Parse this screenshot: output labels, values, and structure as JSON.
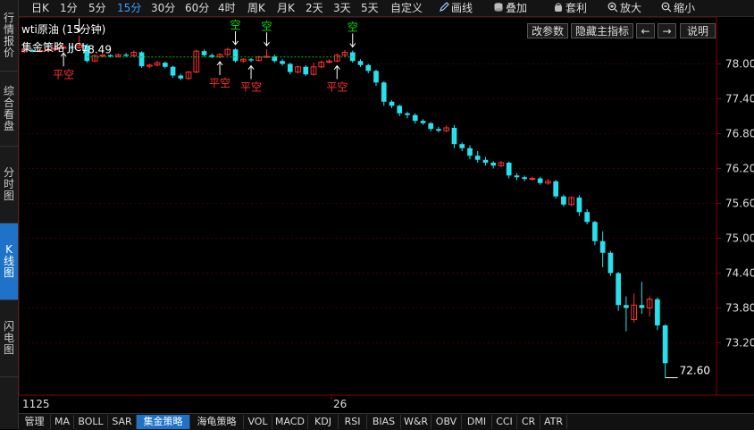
{
  "sidebar": {
    "tabs": [
      {
        "label": "行情报价",
        "active": false
      },
      {
        "label": "综合看盘",
        "active": false
      },
      {
        "label": "分时图",
        "active": false
      },
      {
        "label": "K线图",
        "active": true
      },
      {
        "label": "闪电图",
        "active": false
      }
    ]
  },
  "toolbar": {
    "periods": [
      "日K",
      "1分",
      "5分",
      "15分",
      "30分",
      "60分",
      "4时",
      "周K",
      "月K",
      "2天",
      "3天",
      "5天",
      "自定义"
    ],
    "active_period": "15分",
    "tools": [
      {
        "label": "画线",
        "icon": "pencil-icon"
      },
      {
        "label": "叠加",
        "icon": "database-icon"
      },
      {
        "label": "套利",
        "icon": "bag-icon"
      },
      {
        "label": "放大",
        "icon": "zoom-in-icon"
      },
      {
        "label": "缩小",
        "icon": "zoom-out-icon"
      }
    ]
  },
  "chart_header": {
    "title": "wti原油 (15分钟)",
    "strategy": "集金策略  JJCL"
  },
  "chart_controls": {
    "params": "改参数",
    "hide_indicator": "隐藏主指标",
    "prev": "←",
    "next": "→",
    "help": "说明"
  },
  "chart_data": {
    "type": "candlestick",
    "y_ticks": [
      "78.00",
      "77.40",
      "76.80",
      "76.20",
      "75.60",
      "75.00",
      "74.40",
      "73.80",
      "73.20"
    ],
    "x_labels": [
      "1125",
      "26"
    ],
    "ylim": [
      72.5,
      78.5
    ],
    "high_marker": "78.49",
    "last_price": "72.60",
    "colors": {
      "up": "#ff3030",
      "down": "#27e0ee",
      "signal_open": "#00e000",
      "signal_close": "#ff3030"
    },
    "signals": [
      {
        "label": "平空",
        "type": "close",
        "index": 5
      },
      {
        "label": "空",
        "type": "open",
        "index": 7
      },
      {
        "label": "平空",
        "type": "close",
        "index": 25
      },
      {
        "label": "空",
        "type": "open",
        "index": 27
      },
      {
        "label": "平空",
        "type": "close",
        "index": 29
      },
      {
        "label": "空",
        "type": "open",
        "index": 31
      },
      {
        "label": "平空",
        "type": "close",
        "index": 40
      },
      {
        "label": "空",
        "type": "open",
        "index": 42
      }
    ],
    "candles": [
      [
        78.21,
        78.24,
        78.19,
        78.27
      ],
      [
        78.24,
        78.22,
        78.2,
        78.26
      ],
      [
        78.22,
        78.23,
        78.2,
        78.25
      ],
      [
        78.23,
        78.25,
        78.21,
        78.28
      ],
      [
        78.25,
        78.27,
        78.23,
        78.3
      ],
      [
        78.27,
        78.29,
        78.25,
        78.33
      ],
      [
        78.29,
        78.28,
        78.26,
        78.31
      ],
      [
        78.28,
        78.32,
        78.26,
        78.49
      ],
      [
        78.32,
        78.05,
        78.02,
        78.35
      ],
      [
        78.05,
        78.14,
        78.03,
        78.16
      ],
      [
        78.14,
        78.15,
        78.12,
        78.17
      ],
      [
        78.15,
        78.13,
        78.11,
        78.17
      ],
      [
        78.13,
        78.16,
        78.11,
        78.18
      ],
      [
        78.16,
        78.14,
        78.12,
        78.19
      ],
      [
        78.14,
        78.2,
        78.12,
        78.23
      ],
      [
        78.2,
        77.96,
        77.93,
        78.22
      ],
      [
        77.96,
        77.98,
        77.93,
        78.0
      ],
      [
        77.98,
        78.02,
        77.96,
        78.05
      ],
      [
        78.02,
        77.95,
        77.92,
        78.04
      ],
      [
        77.95,
        77.8,
        77.76,
        77.97
      ],
      [
        77.8,
        77.75,
        77.72,
        77.83
      ],
      [
        77.75,
        77.86,
        77.73,
        77.88
      ],
      [
        77.86,
        78.22,
        77.84,
        78.24
      ],
      [
        78.22,
        78.15,
        78.12,
        78.25
      ],
      [
        78.15,
        78.12,
        78.1,
        78.18
      ],
      [
        78.12,
        78.16,
        78.1,
        78.19
      ],
      [
        78.16,
        78.25,
        78.14,
        78.28
      ],
      [
        78.25,
        78.05,
        78.02,
        78.27
      ],
      [
        78.05,
        78.08,
        78.02,
        78.1
      ],
      [
        78.08,
        78.06,
        78.03,
        78.1
      ],
      [
        78.06,
        78.12,
        78.04,
        78.14
      ],
      [
        78.12,
        78.13,
        78.1,
        78.25
      ],
      [
        78.13,
        78.05,
        78.02,
        78.16
      ],
      [
        78.05,
        78.0,
        77.97,
        78.08
      ],
      [
        78.0,
        77.86,
        77.82,
        78.02
      ],
      [
        77.86,
        77.95,
        77.84,
        77.97
      ],
      [
        77.95,
        77.82,
        77.79,
        77.98
      ],
      [
        77.82,
        77.95,
        77.8,
        78.02
      ],
      [
        77.95,
        78.03,
        77.93,
        78.06
      ],
      [
        78.03,
        78.05,
        78.01,
        78.08
      ],
      [
        78.05,
        78.15,
        78.03,
        78.18
      ],
      [
        78.15,
        78.2,
        78.12,
        78.24
      ],
      [
        78.2,
        78.05,
        78.02,
        78.23
      ],
      [
        78.05,
        77.98,
        77.95,
        78.08
      ],
      [
        77.98,
        77.88,
        77.84,
        78.0
      ],
      [
        77.88,
        77.68,
        77.62,
        77.9
      ],
      [
        77.68,
        77.35,
        77.28,
        77.7
      ],
      [
        77.35,
        77.28,
        77.24,
        77.38
      ],
      [
        77.28,
        77.15,
        77.1,
        77.3
      ],
      [
        77.15,
        77.12,
        77.06,
        77.18
      ],
      [
        77.12,
        77.02,
        76.97,
        77.15
      ],
      [
        77.02,
        76.98,
        76.95,
        77.05
      ],
      [
        76.98,
        76.88,
        76.84,
        77.0
      ],
      [
        76.88,
        76.85,
        76.82,
        76.92
      ],
      [
        76.85,
        76.9,
        76.83,
        76.94
      ],
      [
        76.9,
        76.62,
        76.55,
        76.95
      ],
      [
        76.62,
        76.55,
        76.5,
        76.65
      ],
      [
        76.55,
        76.42,
        76.36,
        76.6
      ],
      [
        76.42,
        76.35,
        76.3,
        76.5
      ],
      [
        76.35,
        76.3,
        76.25,
        76.4
      ],
      [
        76.3,
        76.25,
        76.2,
        76.33
      ],
      [
        76.25,
        76.3,
        76.22,
        76.33
      ],
      [
        76.3,
        76.08,
        76.03,
        76.32
      ],
      [
        76.08,
        76.05,
        76.0,
        76.12
      ],
      [
        76.05,
        76.02,
        75.98,
        76.08
      ],
      [
        76.02,
        76.03,
        75.99,
        76.06
      ],
      [
        76.03,
        75.95,
        75.92,
        76.06
      ],
      [
        75.95,
        75.98,
        75.92,
        76.02
      ],
      [
        75.98,
        75.72,
        75.68,
        76.0
      ],
      [
        75.72,
        75.58,
        75.54,
        75.75
      ],
      [
        75.58,
        75.7,
        75.55,
        75.72
      ],
      [
        75.7,
        75.45,
        75.38,
        75.74
      ],
      [
        75.45,
        75.28,
        75.24,
        75.5
      ],
      [
        75.28,
        74.95,
        74.88,
        75.3
      ],
      [
        74.95,
        74.75,
        74.5,
        75.12
      ],
      [
        74.75,
        74.4,
        74.35,
        74.78
      ],
      [
        74.4,
        73.85,
        73.75,
        74.42
      ],
      [
        73.85,
        73.8,
        73.4,
        74.0
      ],
      [
        73.6,
        73.85,
        73.55,
        74.05
      ],
      [
        73.85,
        73.8,
        73.7,
        74.25
      ],
      [
        73.8,
        73.95,
        73.65,
        74.0
      ],
      [
        73.95,
        73.5,
        73.42,
        73.98
      ],
      [
        73.5,
        72.85,
        72.6,
        73.52
      ]
    ]
  },
  "bottom_tabs": [
    "管理",
    "MA",
    "BOLL",
    "SAR",
    "集金策略",
    "海龟策略",
    "VOL",
    "MACD",
    "KDJ",
    "RSI",
    "BIAS",
    "W&R",
    "OBV",
    "DMI",
    "CCI",
    "CR",
    "ATR"
  ],
  "active_bottom_tab": "集金策略"
}
